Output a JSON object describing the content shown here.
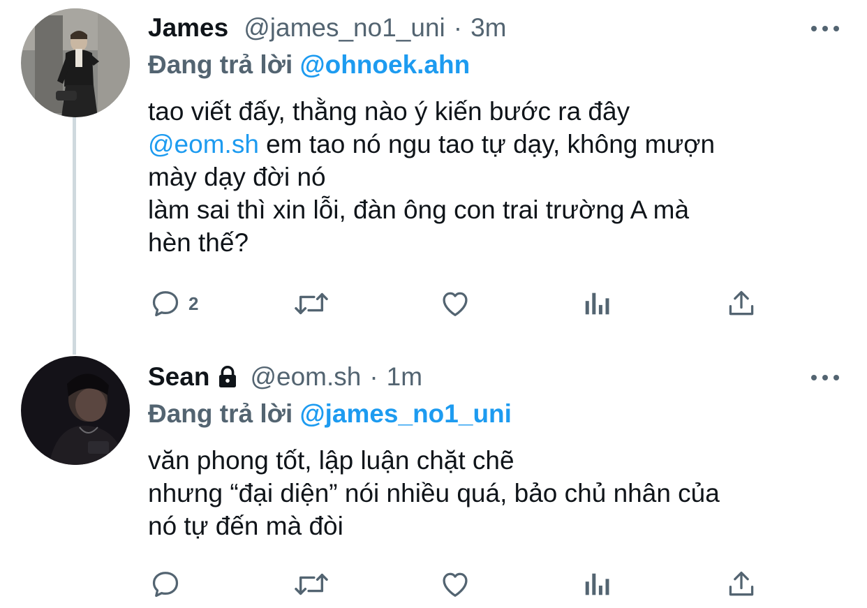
{
  "tweets": [
    {
      "name": "James",
      "handle": "@james_no1_uni",
      "separator": "·",
      "time": "3m",
      "replying_prefix": "Đang trả lời",
      "replying_to": "@ohnoek.ahn",
      "text": {
        "line1": "tao viết đấy, thằng nào ý kiến bước ra đây",
        "line2_mention": "@eom.sh",
        "line2_rest": " em tao nó ngu tao tự dạy, không mượn",
        "line3": "mày dạy đời nó",
        "line4": "làm sai thì xin lỗi, đàn ông con trai trường A mà",
        "line5": "hèn thế?"
      },
      "reply_count": "2",
      "protected": false
    },
    {
      "name": "Sean",
      "handle": "@eom.sh",
      "separator": "·",
      "time": "1m",
      "replying_prefix": "Đang trả lời",
      "replying_to": "@james_no1_uni",
      "text": {
        "line1": "văn phong tốt, lập luận chặt chẽ",
        "line2": "nhưng “đại diện” nói nhiều quá, bảo chủ nhân của",
        "line3": "nó tự đến mà đòi"
      },
      "reply_count": "",
      "protected": true
    }
  ],
  "colors": {
    "link": "#1d9bf0",
    "secondary": "#536471",
    "text": "#0f1419",
    "thread_line": "#cfd9de"
  },
  "icons": [
    "reply-icon",
    "retweet-icon",
    "like-icon",
    "views-icon",
    "share-icon",
    "more-icon",
    "lock-icon"
  ]
}
